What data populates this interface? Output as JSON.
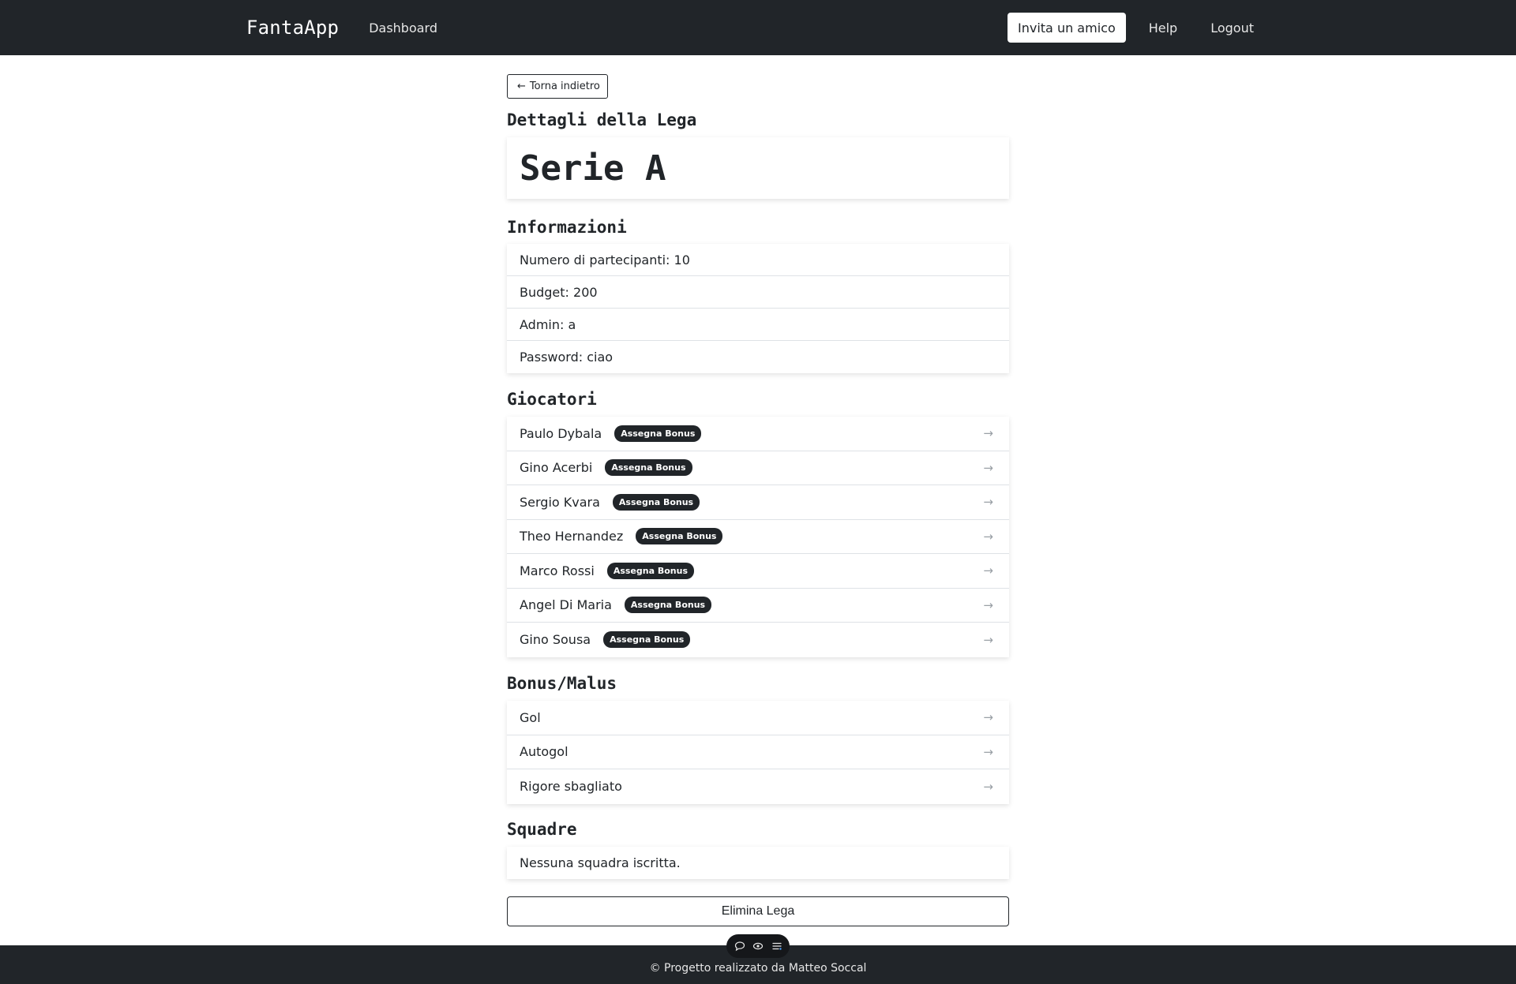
{
  "nav": {
    "brand": "FantaApp",
    "dashboard": "Dashboard",
    "invite": "Invita un amico",
    "help": "Help",
    "logout": "Logout"
  },
  "back_button": {
    "arrow": "←",
    "label": "Torna indietro"
  },
  "league": {
    "section_title": "Dettagli della Lega",
    "name": "Serie A"
  },
  "info": {
    "title": "Informazioni",
    "items": [
      "Numero di partecipanti: 10",
      "Budget: 200",
      "Admin: a",
      "Password: ciao"
    ]
  },
  "players": {
    "title": "Giocatori",
    "badge_label": "Assegna Bonus",
    "items": [
      {
        "name": "Paulo Dybala",
        "badge": "Assegna Bonus"
      },
      {
        "name": "Gino Acerbi",
        "badge": "Assegna Bonus"
      },
      {
        "name": "Sergio Kvara",
        "badge": "Assegna Bonus"
      },
      {
        "name": "Theo Hernandez",
        "badge": "Assegna Bonus"
      },
      {
        "name": "Marco Rossi",
        "badge": "Assegna Bonus"
      },
      {
        "name": "Angel Di Maria",
        "badge": "Assegna Bonus"
      },
      {
        "name": "Gino Sousa",
        "badge": "Assegna Bonus"
      }
    ]
  },
  "bonus": {
    "title": "Bonus/Malus",
    "items": [
      "Gol",
      "Autogol",
      "Rigore sbagliato"
    ]
  },
  "teams": {
    "title": "Squadre",
    "empty": "Nessuna squadra iscritta."
  },
  "delete_button": "Elimina Lega",
  "chevron": "→",
  "footer": "© Progetto realizzato da Matteo Soccal",
  "colors": {
    "dark": "#212529",
    "white": "#ffffff",
    "border": "#dee2e6"
  }
}
